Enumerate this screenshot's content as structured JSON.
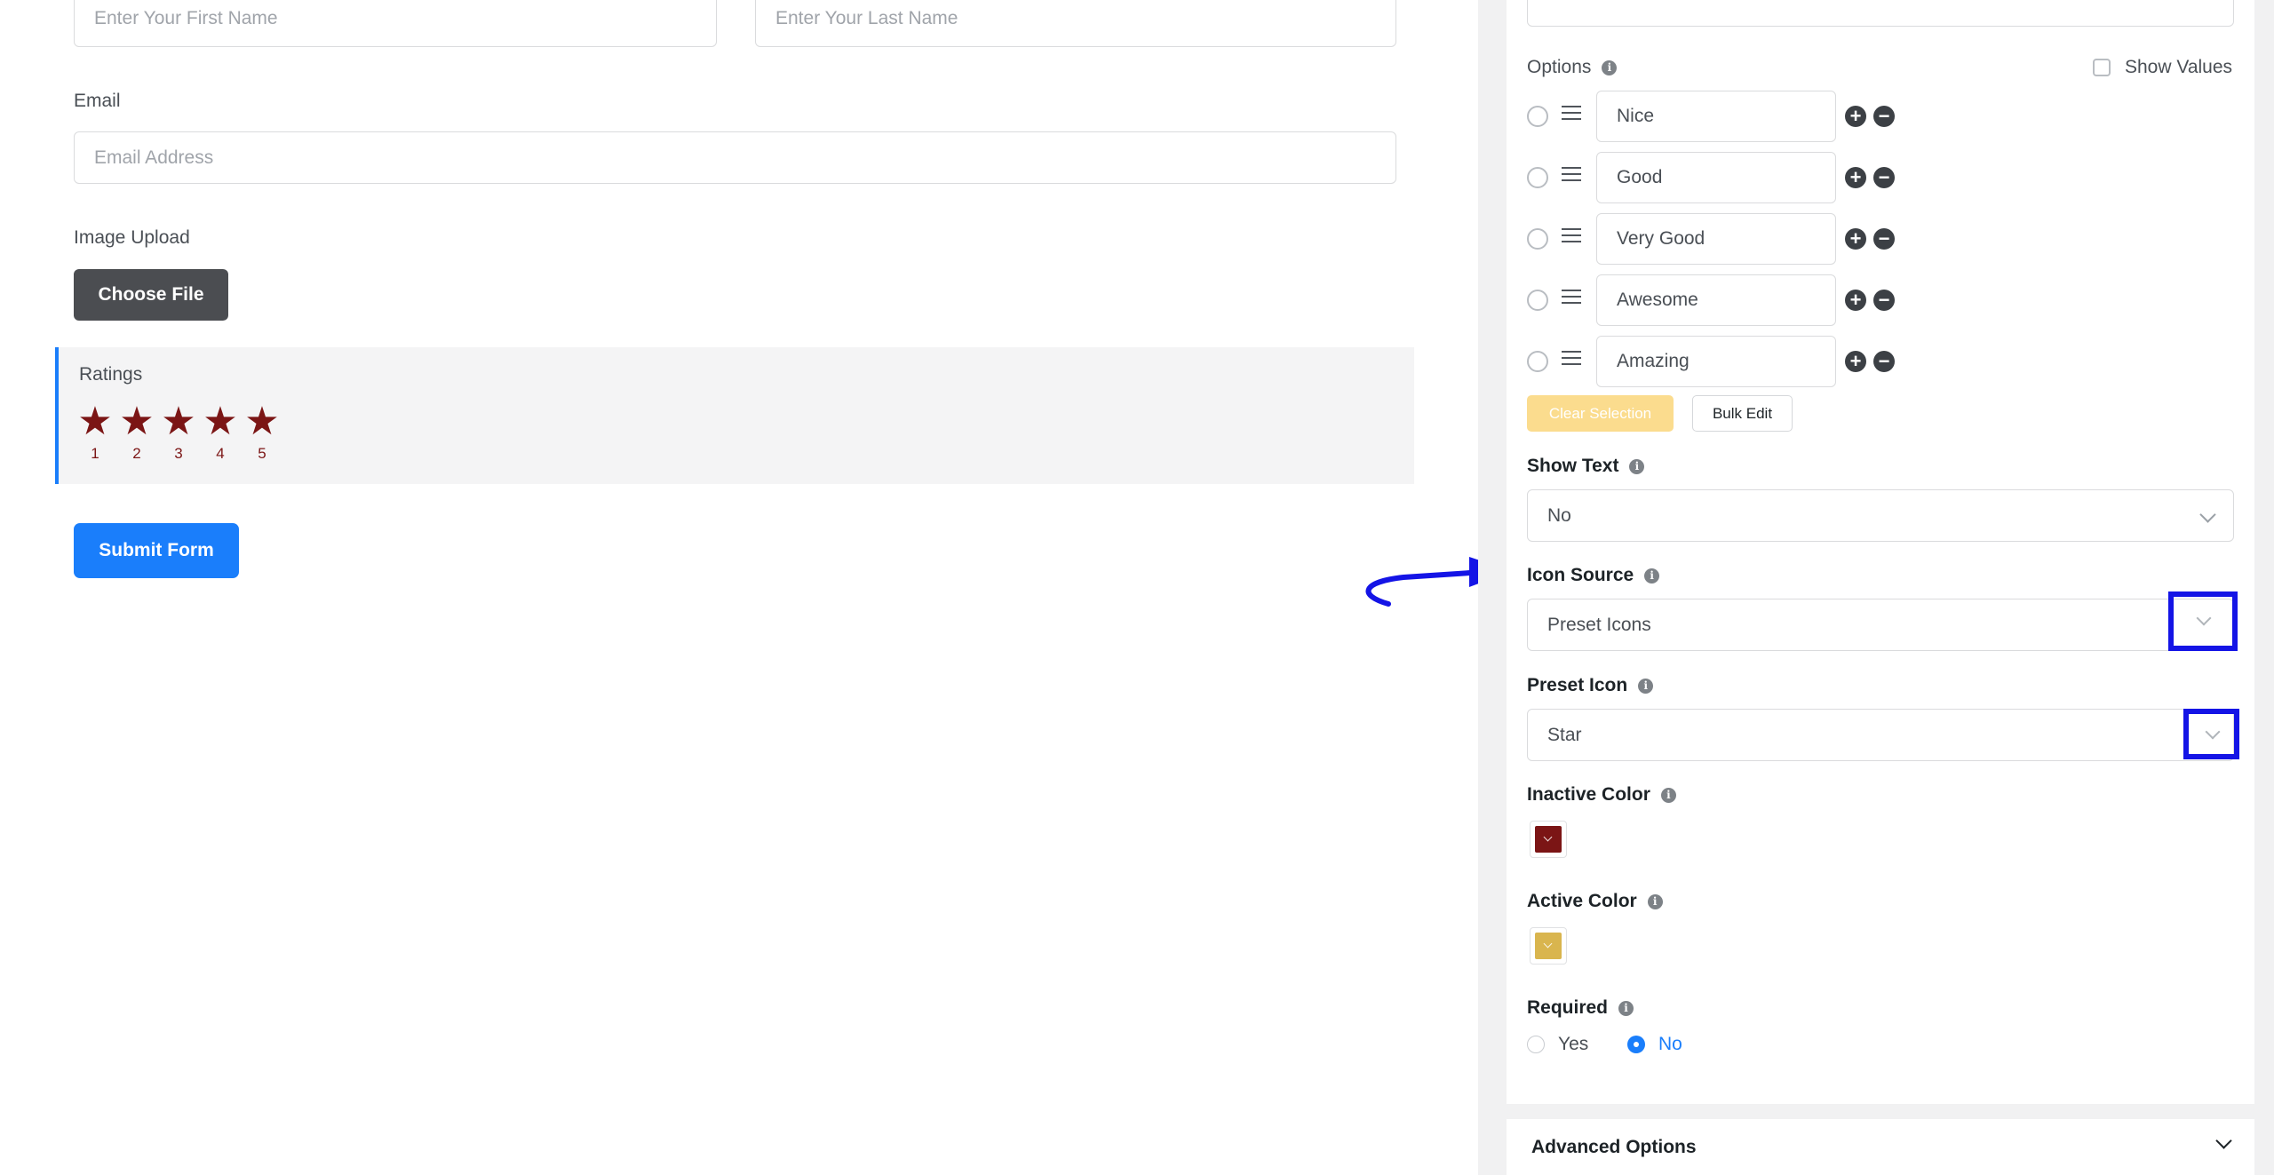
{
  "form": {
    "first_name_placeholder": "Enter Your First Name",
    "last_name_placeholder": "Enter Your Last Name",
    "email_label": "Email",
    "email_placeholder": "Email Address",
    "image_upload_label": "Image Upload",
    "choose_file_label": "Choose File",
    "ratings_label": "Ratings",
    "ratings_stars": [
      {
        "label": "1"
      },
      {
        "label": "2"
      },
      {
        "label": "3"
      },
      {
        "label": "4"
      },
      {
        "label": "5"
      }
    ],
    "submit_label": "Submit Form"
  },
  "settings": {
    "options_label": "Options",
    "show_values_label": "Show Values",
    "options": [
      {
        "value": "Nice"
      },
      {
        "value": "Good"
      },
      {
        "value": "Very Good"
      },
      {
        "value": "Awesome"
      },
      {
        "value": "Amazing"
      }
    ],
    "clear_selection_label": "Clear Selection",
    "bulk_edit_label": "Bulk Edit",
    "show_text_label": "Show Text",
    "show_text_value": "No",
    "icon_source_label": "Icon Source",
    "icon_source_value": "Preset Icons",
    "preset_icon_label": "Preset Icon",
    "preset_icon_value": "Star",
    "inactive_color_label": "Inactive Color",
    "inactive_color": "#7b1515",
    "active_color_label": "Active Color",
    "active_color": "#d9b54e",
    "required_label": "Required",
    "required_options": [
      "Yes",
      "No"
    ],
    "required_selected": "No",
    "advanced_options_label": "Advanced Options"
  },
  "colors": {
    "accent": "#1a7efb",
    "annotation": "#1414e6",
    "star": "#7b1515"
  }
}
